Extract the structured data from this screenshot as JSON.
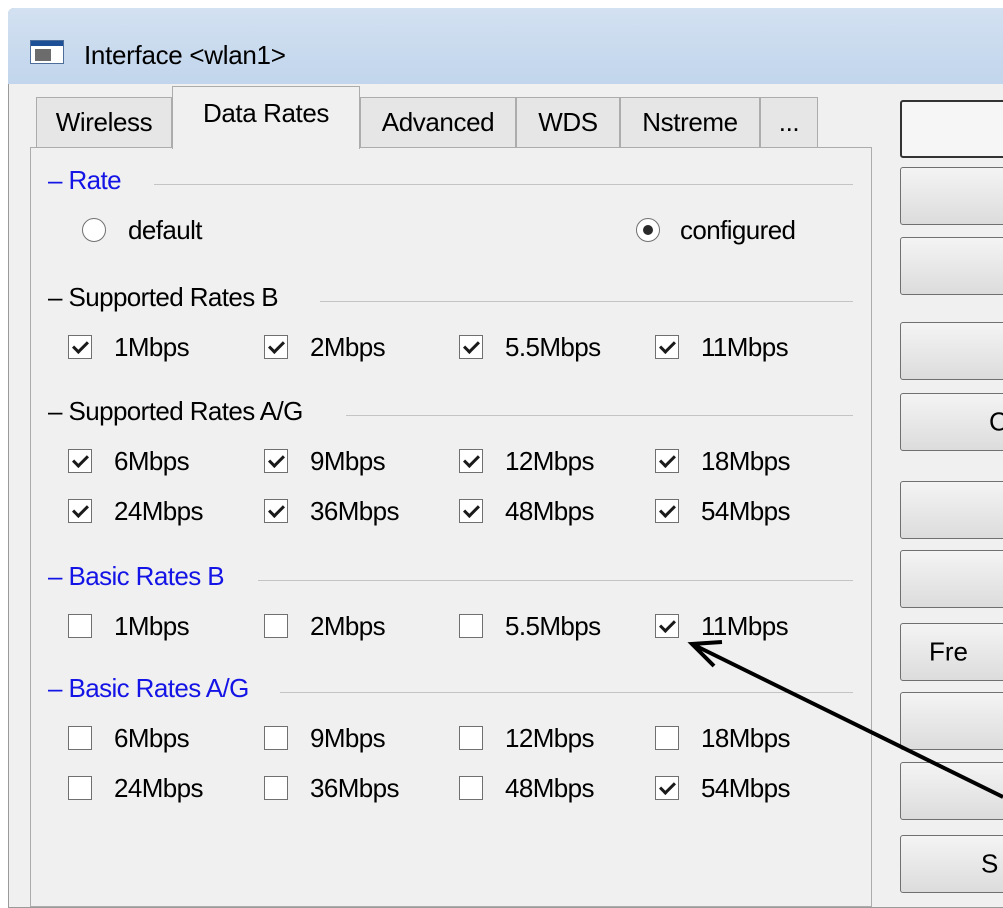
{
  "window": {
    "title": "Interface <wlan1>",
    "icon": "window-icon"
  },
  "tabs": [
    {
      "label": "Wireless",
      "active": false
    },
    {
      "label": "Data Rates",
      "active": true
    },
    {
      "label": "Advanced",
      "active": false
    },
    {
      "label": "WDS",
      "active": false
    },
    {
      "label": "Nstreme",
      "active": false
    },
    {
      "label": "...",
      "active": false
    }
  ],
  "rate": {
    "title": "Rate",
    "options": [
      {
        "label": "default",
        "selected": false
      },
      {
        "label": "configured",
        "selected": true
      }
    ]
  },
  "groups": [
    {
      "title": "Supported Rates B",
      "title_color": "black",
      "rows": [
        [
          {
            "label": "1Mbps",
            "checked": true
          },
          {
            "label": "2Mbps",
            "checked": true
          },
          {
            "label": "5.5Mbps",
            "checked": true
          },
          {
            "label": "11Mbps",
            "checked": true
          }
        ]
      ]
    },
    {
      "title": "Supported Rates A/G",
      "title_color": "black",
      "rows": [
        [
          {
            "label": "6Mbps",
            "checked": true
          },
          {
            "label": "9Mbps",
            "checked": true
          },
          {
            "label": "12Mbps",
            "checked": true
          },
          {
            "label": "18Mbps",
            "checked": true
          }
        ],
        [
          {
            "label": "24Mbps",
            "checked": true
          },
          {
            "label": "36Mbps",
            "checked": true
          },
          {
            "label": "48Mbps",
            "checked": true
          },
          {
            "label": "54Mbps",
            "checked": true
          }
        ]
      ]
    },
    {
      "title": "Basic Rates B",
      "title_color": "blue",
      "rows": [
        [
          {
            "label": "1Mbps",
            "checked": false
          },
          {
            "label": "2Mbps",
            "checked": false
          },
          {
            "label": "5.5Mbps",
            "checked": false
          },
          {
            "label": "11Mbps",
            "checked": true
          }
        ]
      ]
    },
    {
      "title": "Basic Rates A/G",
      "title_color": "blue",
      "rows": [
        [
          {
            "label": "6Mbps",
            "checked": false
          },
          {
            "label": "9Mbps",
            "checked": false
          },
          {
            "label": "12Mbps",
            "checked": false
          },
          {
            "label": "18Mbps",
            "checked": false
          }
        ],
        [
          {
            "label": "24Mbps",
            "checked": false
          },
          {
            "label": "36Mbps",
            "checked": false
          },
          {
            "label": "48Mbps",
            "checked": false
          },
          {
            "label": "54Mbps",
            "checked": true
          }
        ]
      ]
    }
  ],
  "side_buttons": [
    {
      "label": "",
      "default": true
    },
    {
      "label": "",
      "default": false
    },
    {
      "label": "",
      "default": false
    },
    {
      "label": "",
      "default": false
    },
    {
      "label": "C",
      "default": false
    },
    {
      "label": "",
      "default": false
    },
    {
      "label": "",
      "default": false
    },
    {
      "label": "Fre",
      "default": false
    },
    {
      "label": "",
      "default": false
    },
    {
      "label": "",
      "default": false
    },
    {
      "label": "S",
      "default": false
    }
  ],
  "annotation": {
    "icon": "annotation-arrow-icon",
    "points_to": "Basic Rates B 11Mbps checkbox"
  },
  "colors": {
    "group_title_blue": "#1414e6",
    "window_bg": "#f0f0f0",
    "titlebar": "#c9dbef",
    "arrow": "#000000"
  }
}
